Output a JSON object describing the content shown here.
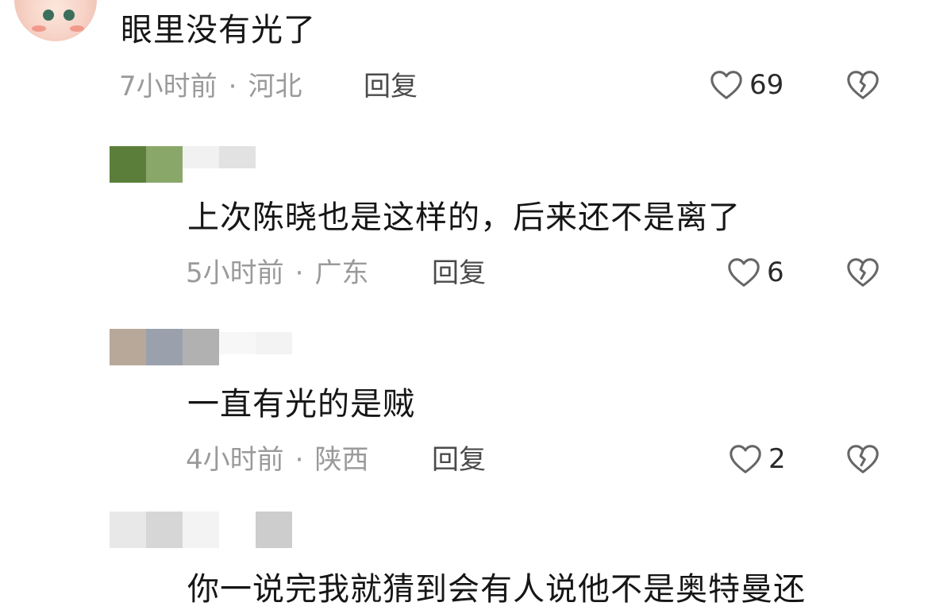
{
  "comments": [
    {
      "text": "眼里没有光了",
      "time": "7小时前",
      "region": "河北",
      "reply_label": "回复",
      "likes": "69"
    },
    {
      "text": "上次陈晓也是这样的，后来还不是离了",
      "time": "5小时前",
      "region": "广东",
      "reply_label": "回复",
      "likes": "6"
    },
    {
      "text": "一直有光的是贼",
      "time": "4小时前",
      "region": "陕西",
      "reply_label": "回复",
      "likes": "2"
    },
    {
      "text": "你一说完我就猜到会有人说他不是奥特曼还"
    }
  ],
  "separator": "·",
  "icons": {
    "like": "heart-outline-icon",
    "dislike": "broken-heart-icon"
  },
  "colors": {
    "text": "#161616",
    "meta": "#9a9a9a",
    "reply": "#4a4a4a",
    "icon": "#666666"
  }
}
